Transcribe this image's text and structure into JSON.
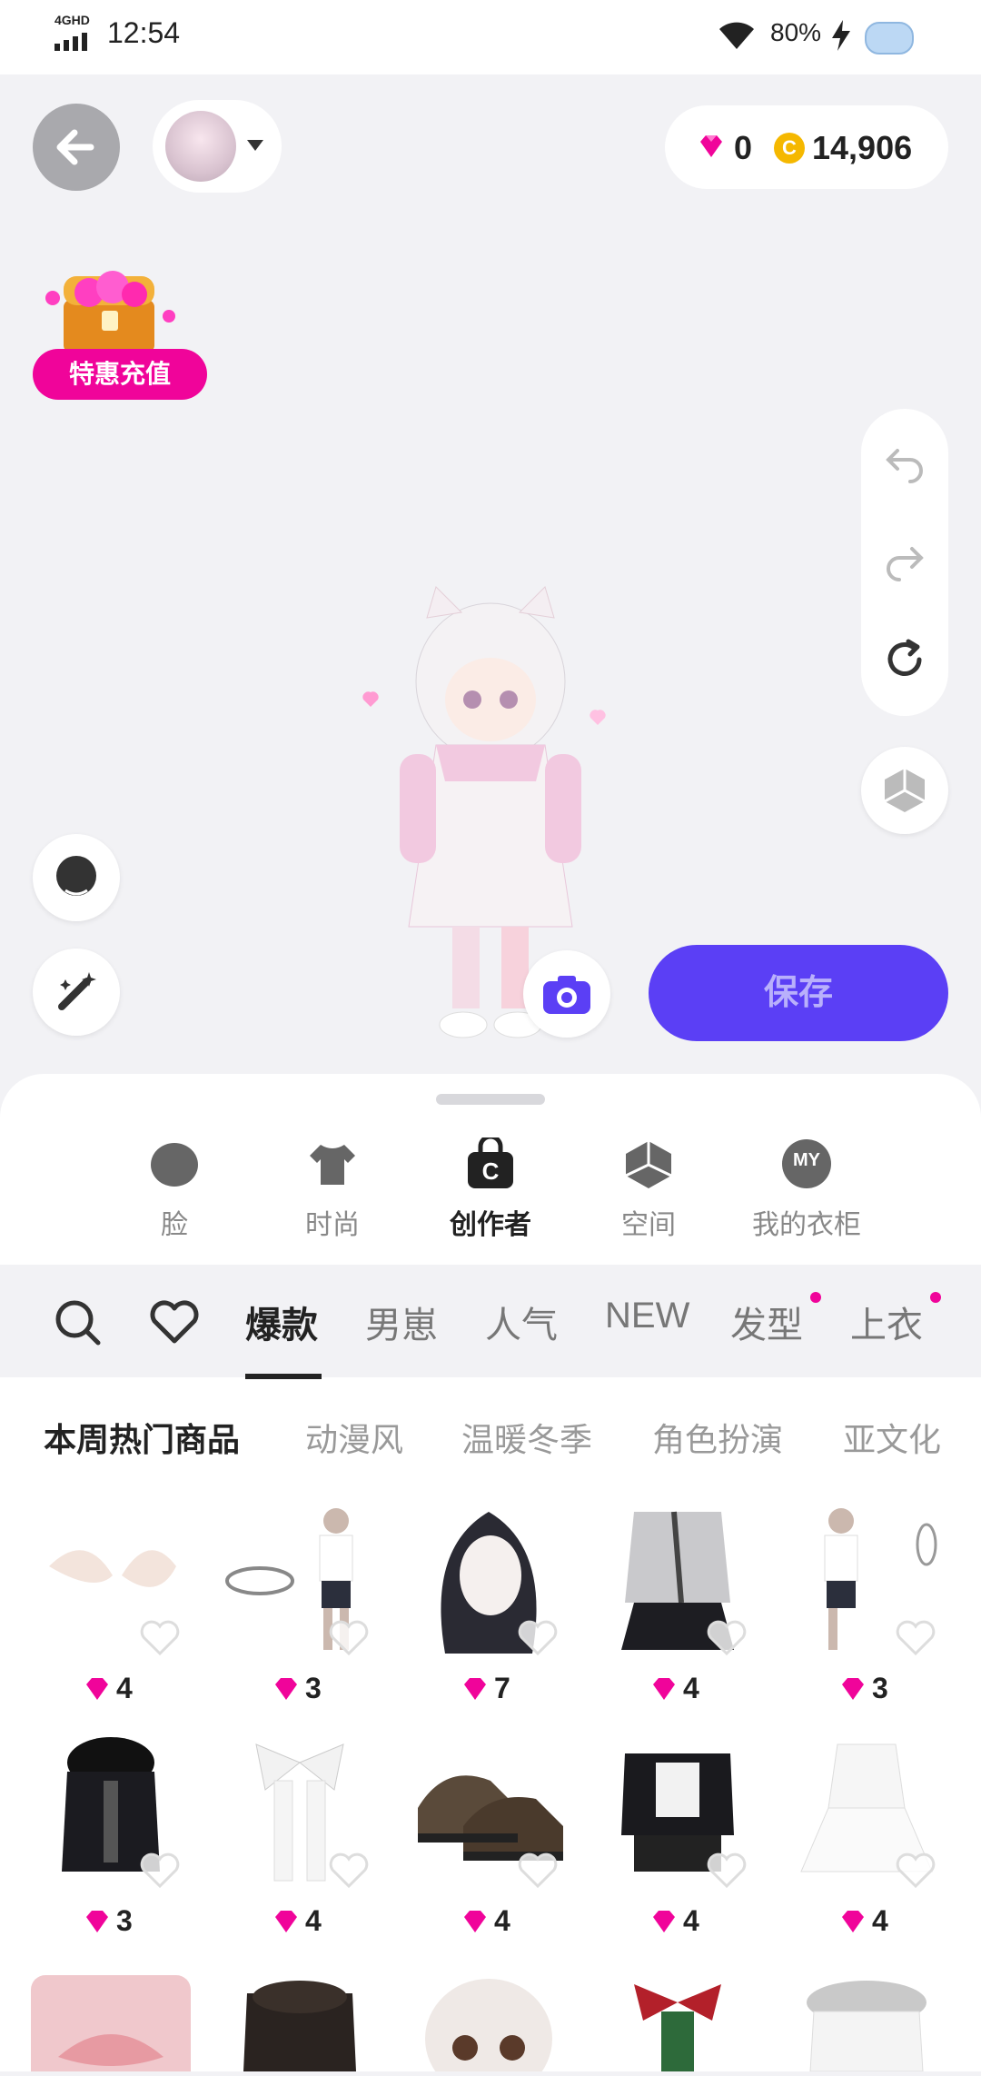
{
  "status_bar": {
    "time": "12:54",
    "network": "4GHD",
    "battery": "80%"
  },
  "header": {
    "diamonds": "0",
    "coins": "14,906",
    "coin_letter": "C"
  },
  "promo": {
    "label": "特惠充值"
  },
  "save_label": "保存",
  "categories": [
    {
      "label": "脸",
      "icon": "face-icon"
    },
    {
      "label": "时尚",
      "icon": "tshirt-icon"
    },
    {
      "label": "创作者",
      "icon": "creator-bag-icon"
    },
    {
      "label": "空间",
      "icon": "cube-icon"
    },
    {
      "label": "我的衣柜",
      "icon": "my-closet-icon",
      "badge": "MY"
    }
  ],
  "tabs": [
    "爆款",
    "男崽",
    "人气",
    "NEW",
    "发型",
    "上衣"
  ],
  "subtabs": [
    "本周热门商品",
    "动漫风",
    "温暖冬季",
    "角色扮演",
    "亚文化"
  ],
  "items_row1": [
    {
      "price": "4",
      "kind": "ears"
    },
    {
      "price": "3",
      "kind": "outfit-necklace"
    },
    {
      "price": "7",
      "kind": "hair"
    },
    {
      "price": "4",
      "kind": "shirt-skirt"
    },
    {
      "price": "3",
      "kind": "earring"
    }
  ],
  "items_row2": [
    {
      "price": "3",
      "kind": "fur-jacket"
    },
    {
      "price": "4",
      "kind": "bow"
    },
    {
      "price": "4",
      "kind": "shoes"
    },
    {
      "price": "4",
      "kind": "leather-outfit"
    },
    {
      "price": "4",
      "kind": "white-dress"
    }
  ],
  "colors": {
    "accent": "#5b3ff5",
    "pink": "#f0049a",
    "coin": "#f5b800"
  }
}
